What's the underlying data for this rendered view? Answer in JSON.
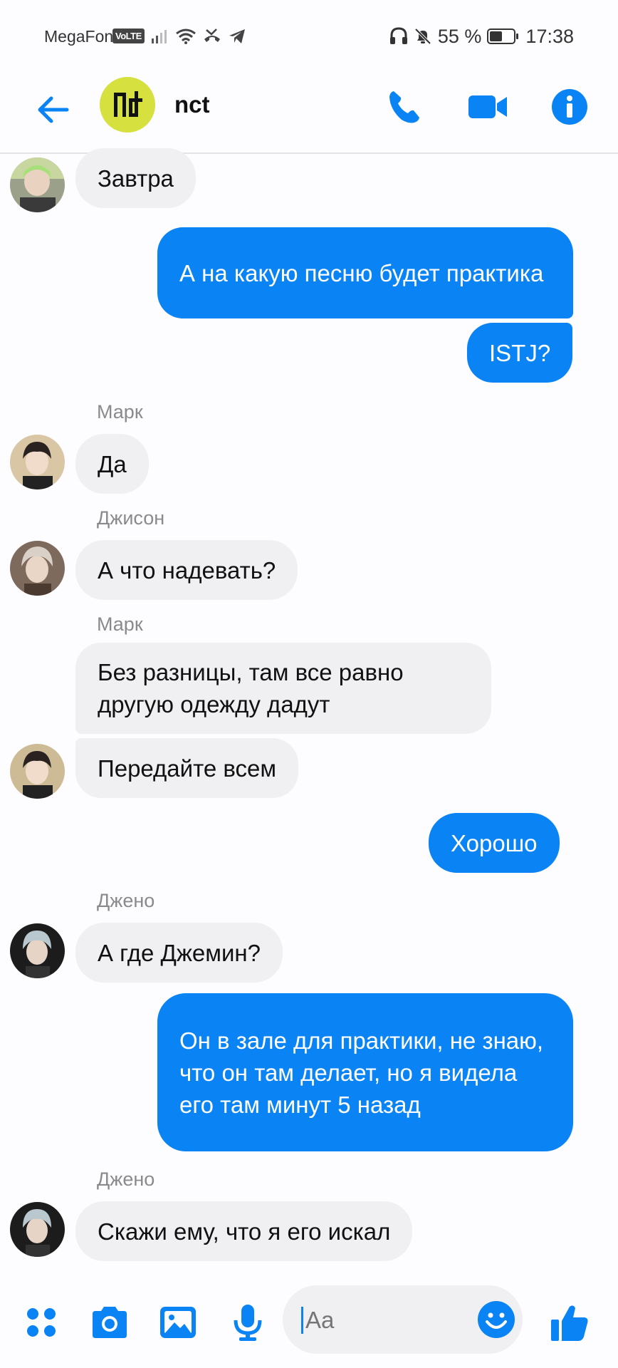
{
  "status_bar": {
    "carrier": "MegaFon",
    "volte": "VoLTE",
    "battery_text": "55 %",
    "battery_level": 0.55,
    "time": "17:38",
    "icons": [
      "signal-icon",
      "wifi-icon",
      "missed-call-icon",
      "telegram-icon",
      "headphones-icon",
      "mute-icon",
      "battery-icon"
    ]
  },
  "header": {
    "title": "nct",
    "avatar_logo": "nct",
    "accent_color": "#0a84f4",
    "icons": [
      "back-arrow-icon",
      "phone-icon",
      "video-camera-icon",
      "info-icon"
    ]
  },
  "messages": [
    {
      "from": "",
      "direction": "in",
      "text": "Завтра"
    },
    {
      "direction": "out",
      "text": "А на какую песню будет практика"
    },
    {
      "direction": "out",
      "text": "ISTJ?"
    },
    {
      "from": "Марк",
      "direction": "in",
      "text": "Да"
    },
    {
      "from": "Джисон",
      "direction": "in",
      "text": "А что надевать?"
    },
    {
      "from": "Марк",
      "direction": "in",
      "text": "Без разницы, там все равно другую одежду дадут"
    },
    {
      "from": "Марк",
      "direction": "in",
      "text": "Передайте всем"
    },
    {
      "direction": "out",
      "text": "Хорошо"
    },
    {
      "from": "Джено",
      "direction": "in",
      "text": "А где Джемин?"
    },
    {
      "direction": "out",
      "text": "Он в зале для практики, не знаю, что он там делает, но я видела его там минут 5 назад"
    },
    {
      "from": "Джено",
      "direction": "in",
      "text": "Скажи ему, что я его искал"
    }
  ],
  "composer": {
    "placeholder": "Aa",
    "icons": [
      "menu-dots-icon",
      "camera-icon",
      "image-icon",
      "microphone-icon",
      "emoji-icon",
      "thumbs-up-icon"
    ]
  }
}
